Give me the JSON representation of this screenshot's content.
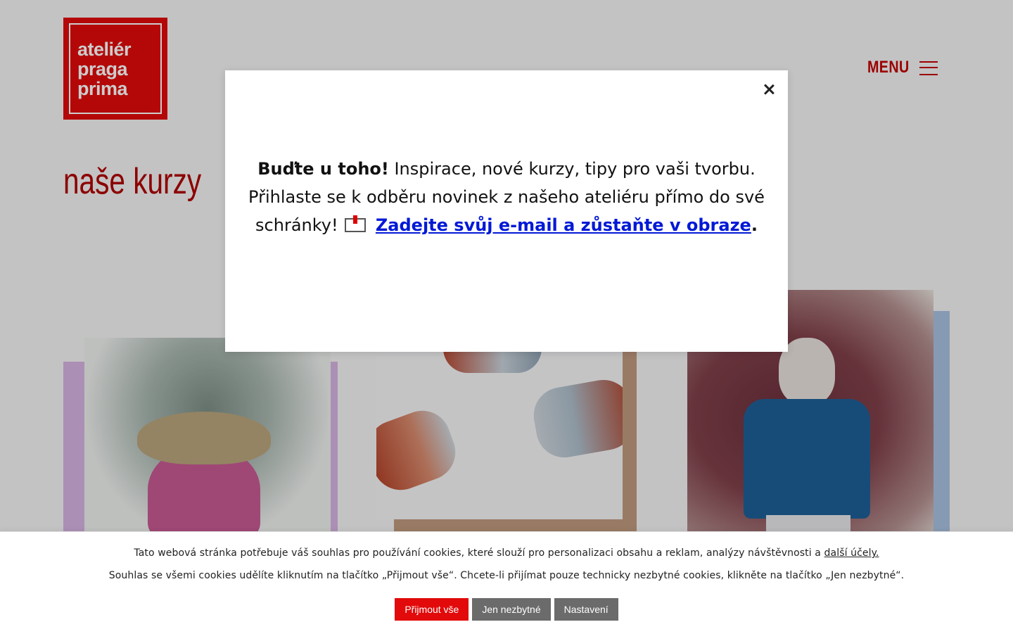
{
  "logo": {
    "lines": [
      "ateliér",
      "praga",
      "prima"
    ]
  },
  "header": {
    "menu_label": "MENU"
  },
  "page": {
    "title": "naše kurzy"
  },
  "modal": {
    "bold_text": "Buďte u toho!",
    "text": " Inspirace, nové kurzy, tipy pro vaši tvorbu. Přihlaste se k odběru novinek z našeho ateliéru přímo do své schránky!",
    "link_text": "Zadejte svůj e-mail a zůstaňte v obraze",
    "trailing": "."
  },
  "cookie": {
    "line1": "Tato webová stránka potřebuje váš souhlas pro používání cookies, které slouží pro personalizaci obsahu a reklam, analýzy návštěvnosti a ",
    "line1_link": "další účely.",
    "line2": "Souhlas se všemi cookies udělíte kliknutím na tlačítko „Přijmout vše“. Chcete-li přijímat pouze technicky nezbytné cookies, klikněte na tlačítko „Jen nezbytné“.",
    "buttons": {
      "accept_all": "Přijmout vše",
      "necessary_only": "Jen nezbytné",
      "settings": "Nastavení"
    }
  },
  "colors": {
    "brand_red": "#e20a0a",
    "title_red": "#b00000",
    "link_blue": "#0019d6",
    "button_grey": "#6b6b6b"
  }
}
